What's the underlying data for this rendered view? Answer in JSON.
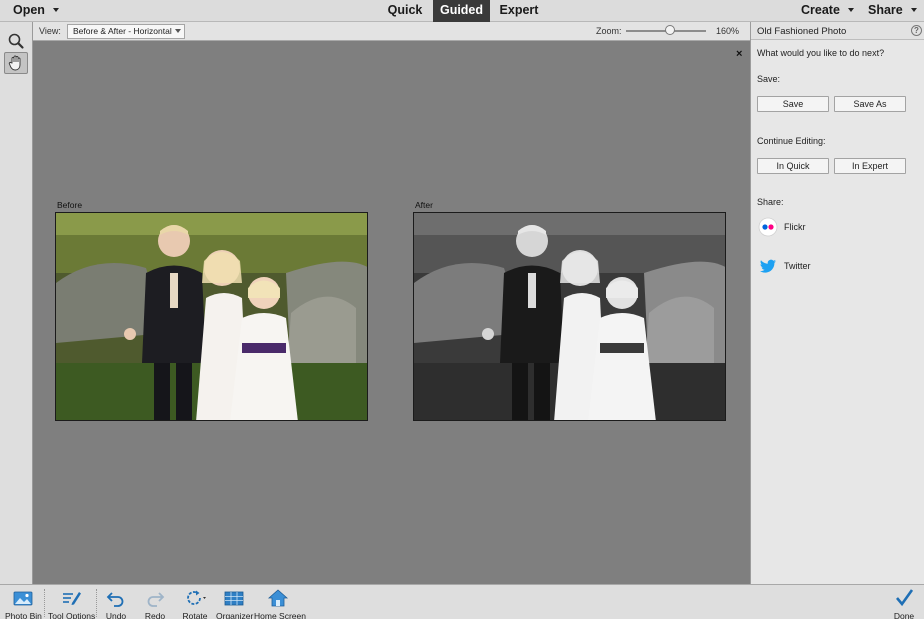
{
  "topbar": {
    "open_label": "Open",
    "modes": [
      "Quick",
      "Guided",
      "Expert"
    ],
    "active_mode": "Guided",
    "create_label": "Create",
    "share_label": "Share"
  },
  "tools": {
    "zoom_icon": "magnifier-icon",
    "hand_icon": "hand-icon"
  },
  "optionsbar": {
    "view_label": "View:",
    "view_value": "Before & After - Horizontal",
    "zoom_label": "Zoom:",
    "zoom_value": "160%",
    "zoom_level_fraction": 0.5
  },
  "canvas": {
    "before_label": "Before",
    "after_label": "After",
    "close_glyph": "×"
  },
  "panel": {
    "title": "Old Fashioned Photo",
    "help_glyph": "?",
    "prompt": "What would you like to do next?",
    "save_heading": "Save:",
    "save_button": "Save",
    "save_as_button": "Save As",
    "continue_heading": "Continue Editing:",
    "in_quick_button": "In Quick",
    "in_expert_button": "In Expert",
    "share_heading": "Share:",
    "share_items": [
      "Flickr",
      "Twitter"
    ]
  },
  "bottombar": {
    "items": [
      "Photo Bin",
      "Tool Options",
      "Undo",
      "Redo",
      "Rotate",
      "Organizer",
      "Home Screen"
    ],
    "done_label": "Done"
  },
  "colors": {
    "accent_blue": "#1b87d4",
    "active_mode_bg": "#3a3a3a",
    "canvas_bg": "#7f7f7f",
    "flickr_pink": "#ff0084",
    "flickr_blue": "#0063dc",
    "twitter_blue": "#1da1f2"
  }
}
